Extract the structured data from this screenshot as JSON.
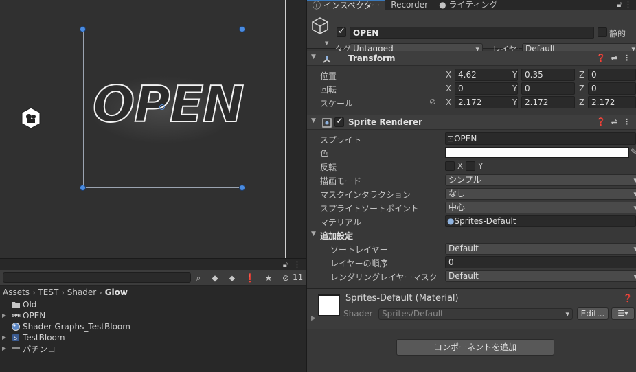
{
  "scene": {
    "open_text": "OPEN"
  },
  "project": {
    "hidden_count": "11",
    "breadcrumb": [
      "Assets",
      "TEST",
      "Shader",
      "Glow"
    ],
    "assets": [
      {
        "name": "Old",
        "icon": "folder-icon",
        "expandable": false
      },
      {
        "name": "OPEN",
        "icon": "sprite-icon",
        "expandable": true
      },
      {
        "name": "Shader Graphs_TestBloom",
        "icon": "material-icon",
        "expandable": false
      },
      {
        "name": "TestBloom",
        "icon": "shader-graph-icon",
        "expandable": true
      },
      {
        "name": "パチンコ",
        "icon": "sprite-icon",
        "expandable": true
      }
    ]
  },
  "inspector": {
    "tabs": [
      {
        "label": "インスペクター",
        "icon": "info-icon",
        "active": true
      },
      {
        "label": "Recorder",
        "icon": "",
        "active": false
      },
      {
        "label": "ライティング",
        "icon": "bulb-icon",
        "active": false
      }
    ],
    "gameobject": {
      "name": "OPEN",
      "static_label": "静的",
      "tag_label": "タグ",
      "tag_value": "Untagged",
      "layer_label": "レイヤー",
      "layer_value": "Default"
    },
    "transform": {
      "title": "Transform",
      "position_label": "位置",
      "rotation_label": "回転",
      "scale_label": "スケール",
      "position": {
        "x": "4.62",
        "y": "0.35",
        "z": "0"
      },
      "rotation": {
        "x": "0",
        "y": "0",
        "z": "0"
      },
      "scale": {
        "x": "2.172",
        "y": "2.172",
        "z": "2.172"
      }
    },
    "sprite_renderer": {
      "title": "Sprite Renderer",
      "sprite_label": "スプライト",
      "sprite_value": "OPEN",
      "color_label": "色",
      "color_value": "#ffffff",
      "flip_label": "反転",
      "flip_x": "X",
      "flip_y": "Y",
      "draw_mode_label": "描画モード",
      "draw_mode_value": "シンプル",
      "mask_label": "マスクインタラクション",
      "mask_value": "なし",
      "sort_point_label": "スプライトソートポイント",
      "sort_point_value": "中心",
      "material_label": "マテリアル",
      "material_value": "Sprites-Default",
      "additional_label": "追加設定",
      "sorting_layer_label": "ソートレイヤー",
      "sorting_layer_value": "Default",
      "order_label": "レイヤーの順序",
      "order_value": "0",
      "render_mask_label": "レンダリングレイヤーマスク",
      "render_mask_value": "Default"
    },
    "material": {
      "title": "Sprites-Default (Material)",
      "shader_label": "Shader",
      "shader_value": "Sprites/Default",
      "edit_label": "Edit..."
    },
    "add_component_label": "コンポーネントを追加"
  }
}
